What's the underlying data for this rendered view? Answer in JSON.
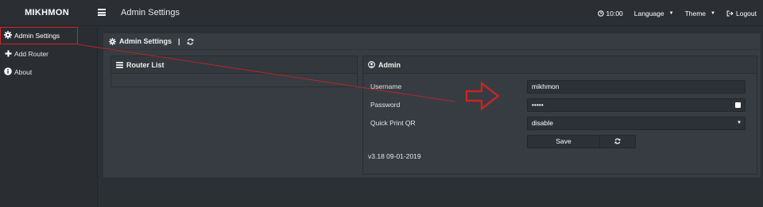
{
  "topbar": {
    "brand": "MIKHMON",
    "page_heading": "Admin Settings",
    "clock": "10:00",
    "language_label": "Language",
    "theme_label": "Theme",
    "logout_label": "Logout"
  },
  "sidebar": {
    "items": [
      {
        "label": "Admin Settings",
        "icon": "gear-icon"
      },
      {
        "label": "Add Router",
        "icon": "plus-icon"
      },
      {
        "label": "About",
        "icon": "info-icon"
      }
    ]
  },
  "main": {
    "title": "Admin Settings",
    "separator": "|"
  },
  "router_list": {
    "title": "Router List"
  },
  "admin": {
    "title": "Admin",
    "username_label": "Username",
    "username_value": "mikhmon",
    "password_label": "Password",
    "password_value": "•••••",
    "qr_label": "Quick Print QR",
    "qr_value": "disable",
    "save_label": "Save",
    "version": "v3.18 09-01-2019"
  },
  "colors": {
    "annotation": "#d32222"
  }
}
